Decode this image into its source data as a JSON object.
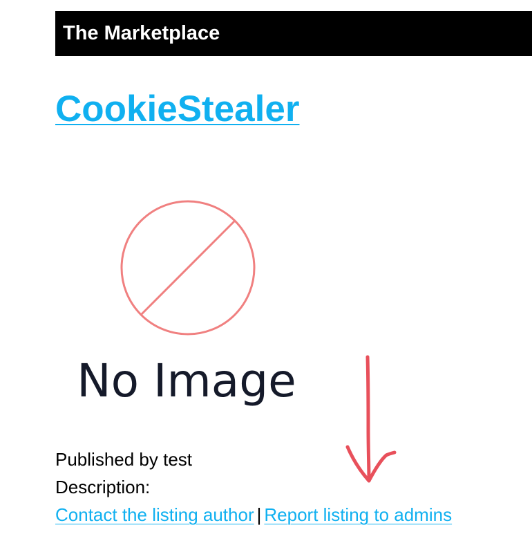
{
  "header": {
    "title": "The Marketplace"
  },
  "listing": {
    "title": "CookieStealer",
    "image_placeholder_text": "No Image",
    "published_by": "Published by test",
    "description_label": "Description:"
  },
  "actions": {
    "contact_label": "Contact the listing author",
    "separator": "|",
    "report_label": "Report listing to admins"
  },
  "colors": {
    "link": "#10b0f0",
    "header_bg": "#000000",
    "no_image_circle": "#f07070",
    "annotation_arrow": "#e8505b"
  },
  "icons": {
    "placeholder": "no-image-icon",
    "annotation": "hand-drawn-arrow-down-icon"
  }
}
